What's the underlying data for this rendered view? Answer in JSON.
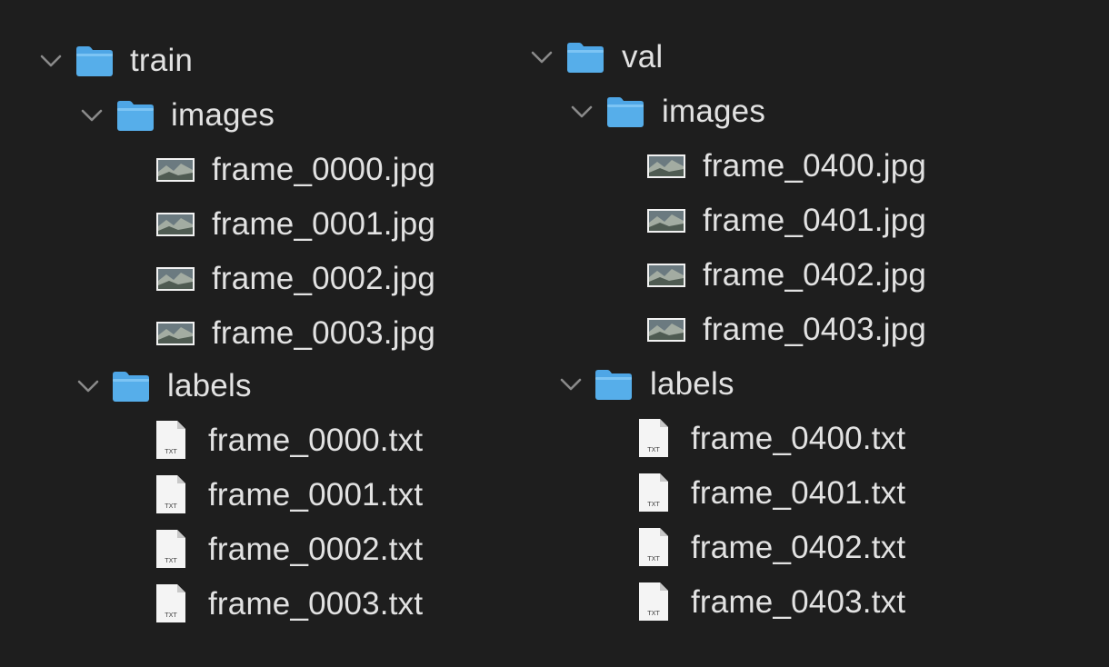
{
  "trees": [
    {
      "name": "train",
      "children": [
        {
          "name": "images",
          "files": [
            "frame_0000.jpg",
            "frame_0001.jpg",
            "frame_0002.jpg",
            "frame_0003.jpg"
          ]
        },
        {
          "name": "labels",
          "files": [
            "frame_0000.txt",
            "frame_0001.txt",
            "frame_0002.txt",
            "frame_0003.txt"
          ]
        }
      ]
    },
    {
      "name": "val",
      "children": [
        {
          "name": "images",
          "files": [
            "frame_0400.jpg",
            "frame_0401.jpg",
            "frame_0402.jpg",
            "frame_0403.jpg"
          ]
        },
        {
          "name": "labels",
          "files": [
            "frame_0400.txt",
            "frame_0401.txt",
            "frame_0402.txt",
            "frame_0403.txt"
          ]
        }
      ]
    }
  ],
  "icons": {
    "chevron": "chevron-down-icon",
    "folder": "folder-icon",
    "image_file": "image-file-icon",
    "text_file": "text-file-icon",
    "text_file_badge": "TXT"
  },
  "colors": {
    "background": "#1e1e1e",
    "text": "#e2e2e2",
    "chevron": "#8a8a8a",
    "folder_top": "#5fb4ef",
    "folder_bottom": "#3d93d6"
  }
}
